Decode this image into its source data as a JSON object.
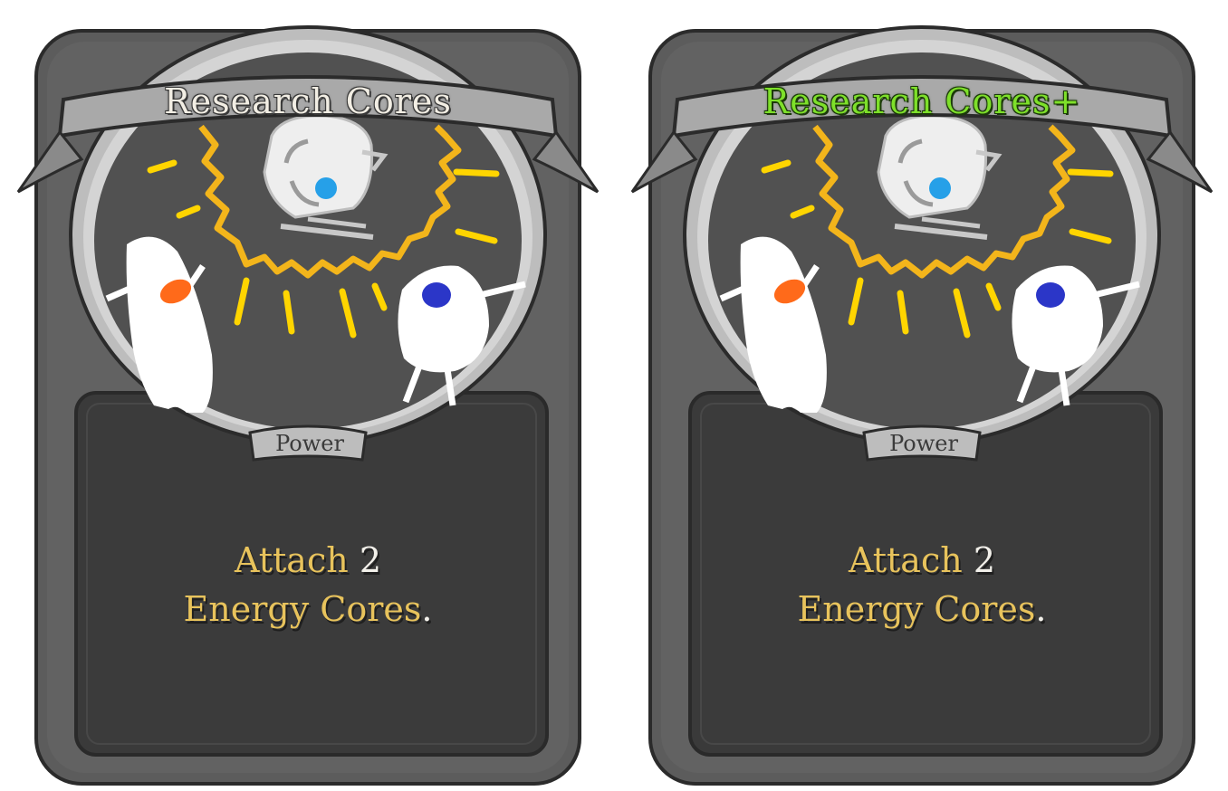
{
  "cards": [
    {
      "title": "Research Cores",
      "upgraded": false,
      "type": "Power",
      "description": {
        "attach_word": "Attach",
        "amount": "2",
        "keyword": "Energy Cores",
        "period": "."
      }
    },
    {
      "title": "Research Cores+",
      "upgraded": true,
      "type": "Power",
      "description": {
        "attach_word": "Attach",
        "amount": "2",
        "keyword": "Energy Cores",
        "period": "."
      }
    }
  ],
  "colors": {
    "frame": "#5a5a5a",
    "frame_border": "#2a2a2a",
    "text_panel": "#3a3a3a",
    "keyword_gold": "#e8c35c",
    "upgrade_green": "#7ee02a",
    "glow_yellow": "#ffd000"
  },
  "icons": [
    "orb-robot-icon",
    "orange-eyed-creature-icon",
    "blue-eyed-creature-icon",
    "sun-burst-icon"
  ]
}
